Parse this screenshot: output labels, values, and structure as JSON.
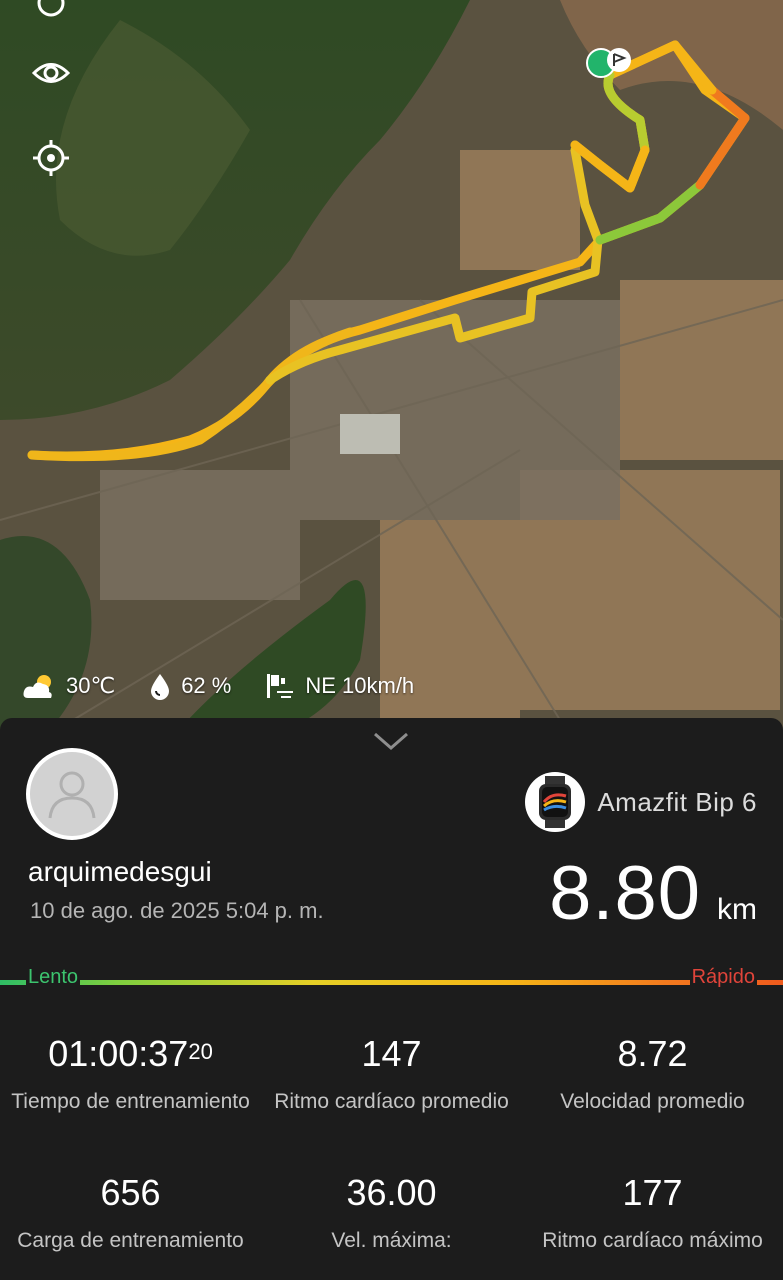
{
  "weather": {
    "temperature": "30℃",
    "humidity": "62 %",
    "wind": "NE 10km/h"
  },
  "summary": {
    "username": "arquimedesgui",
    "datetime": "10 de ago. de 2025 5:04 p. m.",
    "device_name": "Amazfit Bip 6",
    "distance_value": "8.80",
    "distance_unit": "km"
  },
  "speed_scale": {
    "slow_label": "Lento",
    "fast_label": "Rápido",
    "colors": [
      "#2fbd65",
      "#e6cf26",
      "#f5b517",
      "#ef5b1d"
    ]
  },
  "stats": [
    {
      "value": "01:00:37",
      "superscript": "20",
      "label": "Tiempo de entrenamiento"
    },
    {
      "value": "147",
      "label": "Ritmo cardíaco promedio"
    },
    {
      "value": "8.72",
      "label": "Velocidad promedio"
    },
    {
      "value": "656",
      "label": "Carga de entrenamiento"
    },
    {
      "value": "36.00",
      "label": "Vel. máxima:"
    },
    {
      "value": "177",
      "label": "Ritmo cardíaco máximo"
    }
  ],
  "icons": {
    "map_controls": [
      "eye-icon",
      "locate-icon"
    ],
    "weather": [
      "partly-cloudy-icon",
      "humidity-drop-icon",
      "wind-flag-icon"
    ],
    "collapse": "chevron-down-icon",
    "avatar": "user-avatar-icon",
    "device": "smartwatch-icon"
  }
}
